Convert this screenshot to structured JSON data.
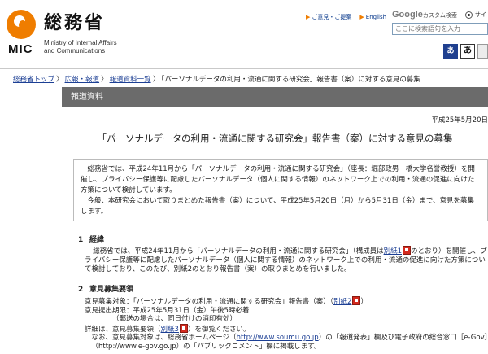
{
  "header": {
    "logo_ja": "総務省",
    "logo_abbr": "MIC",
    "logo_en_line1": "Ministry of Internal Affairs",
    "logo_en_line2": "and Communications",
    "link_contact": "ご意見・ご提案",
    "link_english": "English",
    "google_label": "Google",
    "google_custom": "カスタム検索",
    "radio_label": "サイト",
    "search_placeholder": "ここに検索語句を入力",
    "icon_kana": "あ",
    "icon_a": "あ"
  },
  "breadcrumb": {
    "home": "総務省トップ",
    "pr": "広報・報道",
    "press_list": "報道資料一覧",
    "current": "「パーソナルデータの利用・流通に関する研究会」報告書（案）に対する意見の募集"
  },
  "banner": "報道資料",
  "date": "平成25年5月20日",
  "title": "「パーソナルデータの利用・流通に関する研究会」報告書（案）に対する意見の募集",
  "intro": {
    "p1": "総務省では、平成24年11月から「パーソナルデータの利用・流通に関する研究会」（座長：堀部政男一橋大学名誉教授）を開催し、プライバシー保護等に配慮したパーソナルデータ（個人に関する情報）のネットワーク上での利用・流通の促進に向けた方策について検討しています。",
    "p2": "今般、本研究会において取りまとめた報告書（案）について、平成25年5月20日（月）から5月31日（金）まで、意見を募集します。"
  },
  "section1": {
    "num": "1",
    "heading": "経緯",
    "text_a": "総務省では、平成24年11月から「パーソナルデータの利用・流通に関する研究会」（構成員は",
    "link": "別紙1",
    "text_b": "のとおり）を開催し、プライバシー保護等に配慮したパーソナルデータ（個人に関する情報）のネットワーク上での利用・流通の促進に向けた方策について検討しており、このたび、別紙2のとおり報告書（案）の取りまとめを行いました。"
  },
  "section2": {
    "num": "2",
    "heading": "意見募集要領",
    "line1_a": "意見募集対象：「パーソナルデータの利用・流通に関する研究会」報告書（案）（",
    "line1_link": "別紙2",
    "line1_b": "）",
    "line2": "意見提出期限：平成25年5月31日（金）午後5時必着",
    "line3": "（郵送の場合は、同日付けの消印有効）",
    "line4_a": "詳細は、意見募集要領（",
    "line4_link": "別紙3",
    "line4_b": "）を御覧ください。",
    "line5_a": "なお、意見募集対象は、総務省ホームページ（",
    "line5_link": "http://www.soumu.go.jp",
    "line5_b": "）の「報道発表」欄及び電子政府の総合窓口［e-Gov］（http://www.e-gov.go.jp）の「パブリックコメント」欄に掲載します。"
  },
  "colors": {
    "logo_orange": "#ef7d00",
    "banner_gray": "#6b6b6b",
    "link_blue": "#1c3f94",
    "pdf_red": "#d42a1f"
  }
}
